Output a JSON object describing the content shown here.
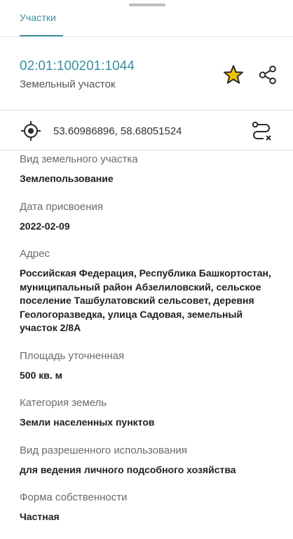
{
  "tab": {
    "label": "Участки"
  },
  "header": {
    "cadastral_number": "02:01:100201:1044",
    "object_type": "Земельный участок",
    "star_color": "#f2c200",
    "accent_color": "#3a8fa0"
  },
  "location": {
    "coordinates": "53.60986896, 58.68051524",
    "locate_icon": "crosshair-icon",
    "route_icon": "route-icon"
  },
  "fields": [
    {
      "label": "Вид земельного участка",
      "value": "Землепользование"
    },
    {
      "label": "Дата присвоения",
      "value": "2022-02-09"
    },
    {
      "label": "Адрес",
      "value": "Российская Федерация, Республика Башкортостан, муниципальный район Абзелиловский, сельское поселение Ташбулатовский сельсовет, деревня Геологоразведка, улица Садовая, земельный участок 2/8А"
    },
    {
      "label": "Площадь уточненная",
      "value": "500 кв. м"
    },
    {
      "label": "Категория земель",
      "value": "Земли населенных пунктов"
    },
    {
      "label": "Вид разрешенного использования",
      "value": "для ведения личного подсобного хозяйства"
    },
    {
      "label": "Форма собственности",
      "value": "Частная"
    }
  ]
}
